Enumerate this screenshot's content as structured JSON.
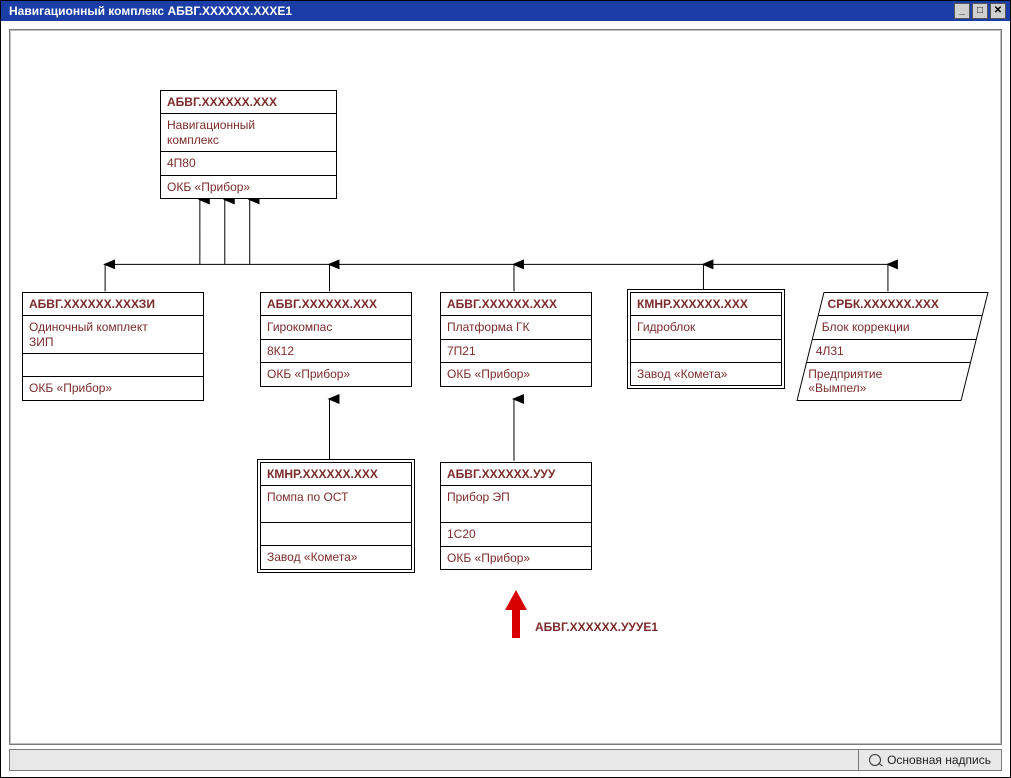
{
  "window": {
    "title": "Навигационный комплекс АБВГ.ХХХХХХ.ХХХЕ1",
    "controls": {
      "minimize": "minimize",
      "maximize": "maximize",
      "close": "close"
    }
  },
  "status": {
    "label": "Основная надпись"
  },
  "callout": {
    "label": "АБВГ.ХХХХХХ.УУУЕ1"
  },
  "nodes": {
    "root": {
      "title": "АБВГ.ХХХХХХ.ХХХ",
      "l1": "Навигационный\nкомплекс",
      "l2": "4П80",
      "l3": "ОКБ «Прибор»"
    },
    "zip": {
      "title": "АБВГ.ХХХХХХ.ХХХЗИ",
      "l1": "Одиночный комплект\nЗИП",
      "l2": "",
      "l3": "ОКБ «Прибор»"
    },
    "gyro": {
      "title": "АБВГ.ХХХХХХ.ХХХ",
      "l1": "Гирокомпас",
      "l2": "8К12",
      "l3": "ОКБ «Прибор»"
    },
    "plat": {
      "title": "АБВГ.ХХХХХХ.ХХХ",
      "l1": "Платформа ГК",
      "l2": "7П21",
      "l3": "ОКБ «Прибор»"
    },
    "hydro": {
      "title": "КМНР.ХХХХХХ.ХХХ",
      "l1": "Гидроблок",
      "l2": "",
      "l3": "Завод «Комета»"
    },
    "corr": {
      "title": "СРБК.ХХХХХХ.ХХХ",
      "l1": "Блок коррекции",
      "l2": "4Л31",
      "l3": "Предприятие\n«Вымпел»"
    },
    "pump": {
      "title": "КМНР.ХХХХХХ.ХХХ",
      "l1": "Помпа по ОСТ",
      "l2": "",
      "l3": "Завод «Комета»"
    },
    "device": {
      "title": "АБВГ.ХХХХХХ.УУУ",
      "l1": "Прибор ЭП",
      "l2": "1С20",
      "l3": "ОКБ «Прибор»"
    }
  }
}
